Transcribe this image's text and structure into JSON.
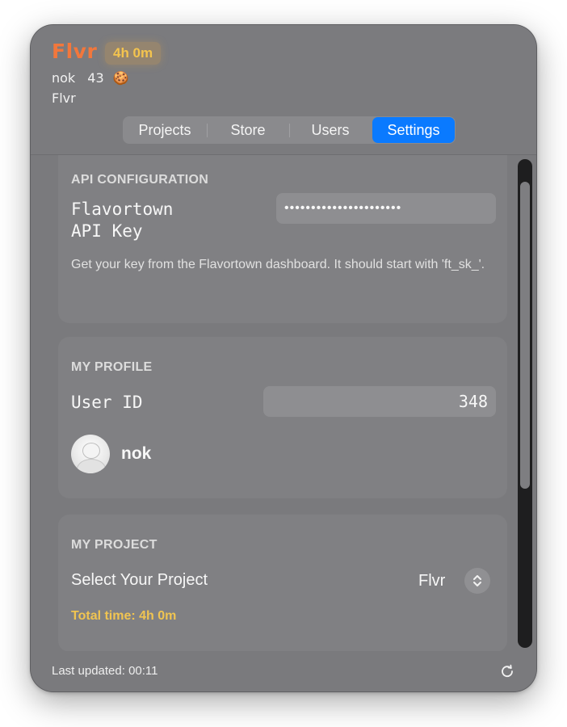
{
  "app": {
    "logo": "Flvr",
    "time_badge": "4h 0m",
    "username": "nok",
    "cookie_count": "43",
    "cookie_icon": "🍪",
    "subtitle": "Flvr"
  },
  "tabs": [
    {
      "label": "Projects",
      "active": false
    },
    {
      "label": "Store",
      "active": false
    },
    {
      "label": "Users",
      "active": false
    },
    {
      "label": "Settings",
      "active": true
    }
  ],
  "api_config": {
    "section_title": "API CONFIGURATION",
    "field_label_line1": "Flavortown",
    "field_label_line2": "API Key",
    "field_value_masked": "••••••••••••••••••••••",
    "help_text": "Get your key from the Flavortown dashboard. It should start with 'ft_sk_'."
  },
  "profile": {
    "section_title": "MY PROFILE",
    "user_id_label": "User ID",
    "user_id_value": "348",
    "name": "nok"
  },
  "project": {
    "section_title": "MY PROJECT",
    "select_label": "Select Your Project",
    "selected_value": "Flvr",
    "total_time": "Total time: 4h 0m"
  },
  "footer": {
    "last_updated": "Last updated: 00:11"
  },
  "colors": {
    "accent": "#0a7aff",
    "logo": "#f2773c",
    "highlight": "#f0c451",
    "window_bg": "#7a7a7d"
  },
  "icons": {
    "refresh": "refresh-icon",
    "stepper": "chevron-up-down-icon",
    "avatar": "avatar-icon"
  }
}
